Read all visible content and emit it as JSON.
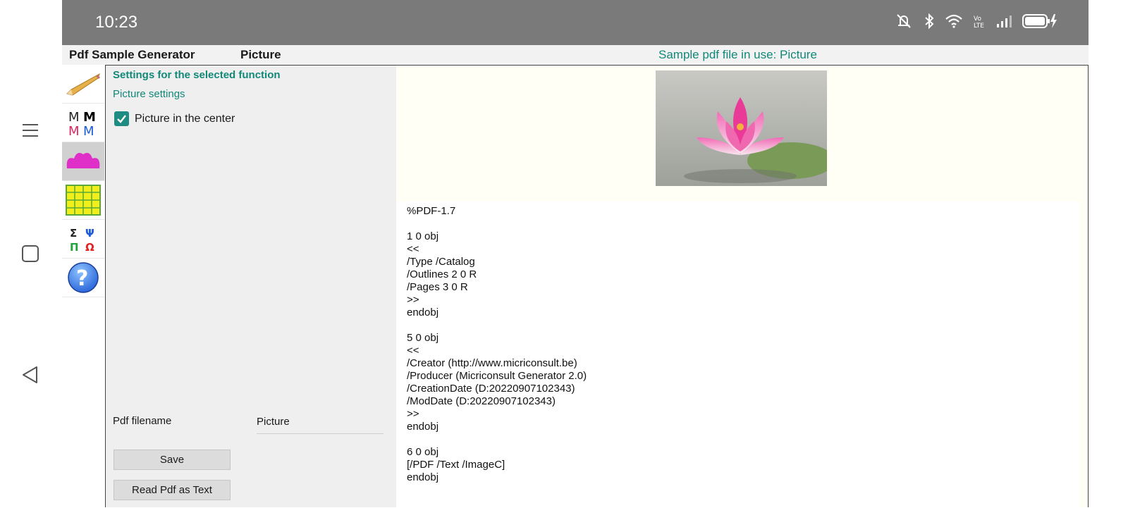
{
  "status": {
    "time": "10:23"
  },
  "header": {
    "app_title": "Pdf Sample Generator",
    "function_title": "Picture",
    "sample_info": "Sample pdf file in use: Picture"
  },
  "toolbar": {
    "items": [
      {
        "icon": "pencil-icon"
      },
      {
        "icon": "fonts-icon"
      },
      {
        "icon": "lotus-picture-icon",
        "active": true
      },
      {
        "icon": "table-grid-icon"
      },
      {
        "icon": "greek-symbols-icon"
      },
      {
        "icon": "help-icon"
      }
    ],
    "symbols": [
      "Σ",
      "Ψ",
      "Π",
      "Ω"
    ],
    "fonts": [
      "M",
      "M",
      "M",
      "M"
    ]
  },
  "settings": {
    "title": "Settings for the selected function",
    "subtitle": "Picture settings",
    "center_checkbox_label": "Picture in the center",
    "center_checked": true,
    "filename_label": "Pdf filename",
    "filename_value": "Picture",
    "save_label": "Save",
    "read_label": "Read Pdf as Text"
  },
  "preview": {
    "pdf_text": "%PDF-1.7\n\n1 0 obj\n<<\n/Type /Catalog\n/Outlines 2 0 R\n/Pages 3 0 R\n>>\nendobj\n\n5 0 obj\n<<\n/Creator (http://www.micriconsult.be)\n/Producer (Micriconsult Generator 2.0)\n/CreationDate (D:20220907102343)\n/ModDate (D:20220907102343)\n>>\nendobj\n\n6 0 obj\n[/PDF /Text /ImageC]\nendobj"
  },
  "colors": {
    "accent": "#118878",
    "statusbar": "#7a7a7a",
    "checkbox": "#1f8c84"
  }
}
